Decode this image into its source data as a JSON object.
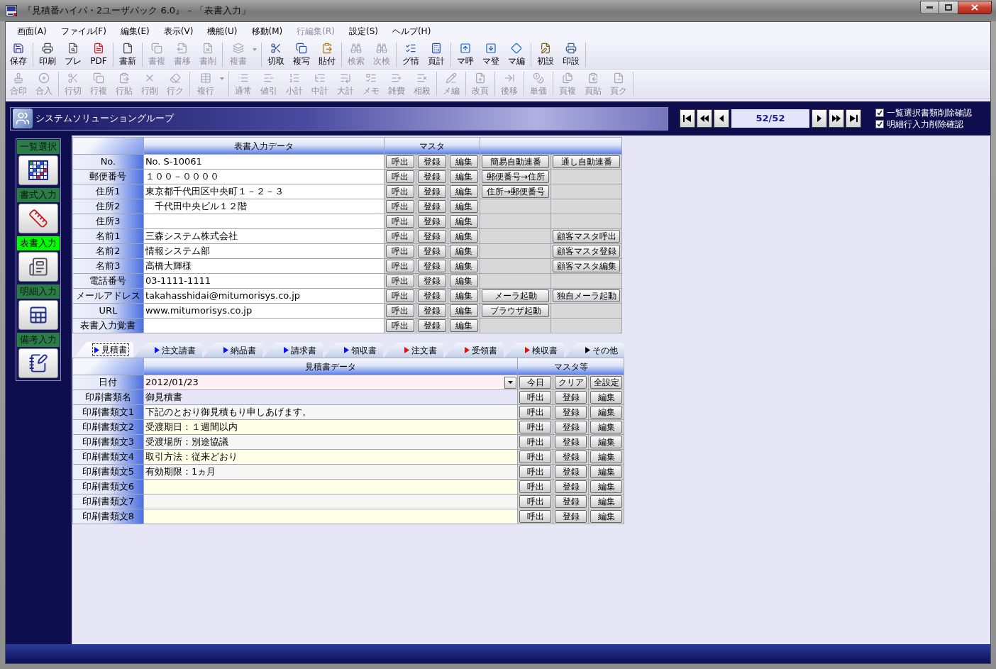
{
  "window": {
    "title": "『見積番ハイパ・2ユーザパック 6.0』 – 「表書入力」"
  },
  "menu": [
    {
      "label": "画面(A)",
      "disabled": false
    },
    {
      "label": "ファイル(F)",
      "disabled": false
    },
    {
      "label": "編集(E)",
      "disabled": false
    },
    {
      "label": "表示(V)",
      "disabled": false
    },
    {
      "label": "機能(U)",
      "disabled": false
    },
    {
      "label": "移動(M)",
      "disabled": false
    },
    {
      "label": "行編集(R)",
      "disabled": true
    },
    {
      "label": "設定(S)",
      "disabled": false
    },
    {
      "label": "ヘルプ(H)",
      "disabled": false
    }
  ],
  "toolbars": [
    {
      "items": [
        {
          "kind": "button",
          "label": "保存",
          "disabled": false
        },
        {
          "kind": "separator"
        },
        {
          "kind": "button",
          "label": "印刷",
          "disabled": false
        },
        {
          "kind": "button",
          "label": "プレ",
          "disabled": false
        },
        {
          "kind": "button",
          "label": "PDF",
          "disabled": false
        },
        {
          "kind": "separator"
        },
        {
          "kind": "button",
          "label": "書新",
          "disabled": false
        },
        {
          "kind": "separator"
        },
        {
          "kind": "button",
          "label": "書複",
          "disabled": true
        },
        {
          "kind": "button",
          "label": "書移",
          "disabled": true
        },
        {
          "kind": "button",
          "label": "書削",
          "disabled": true
        },
        {
          "kind": "separator"
        },
        {
          "kind": "button",
          "label": "複書",
          "disabled": true,
          "dropdown": true
        },
        {
          "kind": "separator"
        },
        {
          "kind": "button",
          "label": "切取",
          "disabled": false
        },
        {
          "kind": "button",
          "label": "複写",
          "disabled": false
        },
        {
          "kind": "button",
          "label": "貼付",
          "disabled": false
        },
        {
          "kind": "separator"
        },
        {
          "kind": "button",
          "label": "検索",
          "disabled": true
        },
        {
          "kind": "button",
          "label": "次検",
          "disabled": true
        },
        {
          "kind": "separator"
        },
        {
          "kind": "button",
          "label": "グ情",
          "disabled": false
        },
        {
          "kind": "button",
          "label": "頁計",
          "disabled": false
        },
        {
          "kind": "separator"
        },
        {
          "kind": "button",
          "label": "マ呼",
          "disabled": false
        },
        {
          "kind": "button",
          "label": "マ登",
          "disabled": false
        },
        {
          "kind": "button",
          "label": "マ編",
          "disabled": false
        },
        {
          "kind": "separator"
        },
        {
          "kind": "button",
          "label": "初設",
          "disabled": false
        },
        {
          "kind": "button",
          "label": "印設",
          "disabled": false
        },
        {
          "kind": "separator"
        }
      ]
    },
    {
      "items": [
        {
          "kind": "button",
          "label": "合印",
          "disabled": true
        },
        {
          "kind": "button",
          "label": "合入",
          "disabled": true
        },
        {
          "kind": "separator"
        },
        {
          "kind": "button",
          "label": "行切",
          "disabled": true
        },
        {
          "kind": "button",
          "label": "行複",
          "disabled": true
        },
        {
          "kind": "button",
          "label": "行貼",
          "disabled": true
        },
        {
          "kind": "button",
          "label": "行削",
          "disabled": true
        },
        {
          "kind": "button",
          "label": "行ク",
          "disabled": true
        },
        {
          "kind": "separator"
        },
        {
          "kind": "button",
          "label": "複行",
          "disabled": true,
          "dropdown": true
        },
        {
          "kind": "separator"
        },
        {
          "kind": "button",
          "label": "通常",
          "disabled": true
        },
        {
          "kind": "button",
          "label": "値引",
          "disabled": true
        },
        {
          "kind": "button",
          "label": "小計",
          "disabled": true
        },
        {
          "kind": "button",
          "label": "中計",
          "disabled": true
        },
        {
          "kind": "button",
          "label": "大計",
          "disabled": true
        },
        {
          "kind": "button",
          "label": "メモ",
          "disabled": true
        },
        {
          "kind": "button",
          "label": "雑費",
          "disabled": true
        },
        {
          "kind": "button",
          "label": "相殺",
          "disabled": true
        },
        {
          "kind": "separator"
        },
        {
          "kind": "button",
          "label": "メ編",
          "disabled": true
        },
        {
          "kind": "separator"
        },
        {
          "kind": "button",
          "label": "改頁",
          "disabled": true
        },
        {
          "kind": "separator"
        },
        {
          "kind": "button",
          "label": "後移",
          "disabled": true
        },
        {
          "kind": "separator"
        },
        {
          "kind": "button",
          "label": "単価",
          "disabled": true
        },
        {
          "kind": "separator"
        },
        {
          "kind": "button",
          "label": "頁複",
          "disabled": true
        },
        {
          "kind": "button",
          "label": "頁貼",
          "disabled": true
        },
        {
          "kind": "button",
          "label": "頁ク",
          "disabled": true
        },
        {
          "kind": "separator"
        }
      ]
    }
  ],
  "header": {
    "group_name": "システムソリューショングループ",
    "record": "52/52",
    "options": [
      {
        "label": "一覧選択書類削除確認",
        "checked": true
      },
      {
        "label": "明細行入力削除確認",
        "checked": true
      }
    ]
  },
  "sidebar": [
    {
      "label": "一覧選択",
      "selected": false
    },
    {
      "label": "書式入力",
      "selected": false
    },
    {
      "label": "表書入力",
      "selected": true
    },
    {
      "label": "明細入力",
      "selected": false
    },
    {
      "label": "備考入力",
      "selected": false
    }
  ],
  "cover_table": {
    "columns": [
      "表書入力データ",
      "マスタ"
    ],
    "rows": [
      {
        "label": "No.",
        "value": "No. S-10061",
        "buttons": [
          "呼出",
          "登録",
          "編集"
        ],
        "action_1": "簡易自動連番",
        "action_2": "通し自動連番"
      },
      {
        "label": "郵便番号",
        "value": "１００－００００",
        "buttons": [
          "呼出",
          "登録",
          "編集"
        ],
        "action_1": "郵便番号→住所"
      },
      {
        "label": "住所1",
        "value": "東京都千代田区中央町１－２－３",
        "buttons": [
          "呼出",
          "登録",
          "編集"
        ],
        "action_1": "住所→郵便番号"
      },
      {
        "label": "住所2",
        "value": "　千代田中央ビル１２階",
        "buttons": [
          "呼出",
          "登録",
          "編集"
        ]
      },
      {
        "label": "住所3",
        "buttons": [
          "呼出",
          "登録",
          "編集"
        ]
      },
      {
        "label": "名前1",
        "value": "三森システム株式会社",
        "buttons": [
          "呼出",
          "登録",
          "編集"
        ],
        "action_2": "顧客マスタ呼出"
      },
      {
        "label": "名前2",
        "value": "情報システム部",
        "buttons": [
          "呼出",
          "登録",
          "編集"
        ],
        "action_2": "顧客マスタ登録"
      },
      {
        "label": "名前3",
        "value": "高橋大輝様",
        "buttons": [
          "呼出",
          "登録",
          "編集"
        ],
        "action_2": "顧客マスタ編集"
      },
      {
        "label": "電話番号",
        "value": "03-1111-1111",
        "buttons": [
          "呼出",
          "登録",
          "編集"
        ]
      },
      {
        "label": "メールアドレス",
        "value": "takahasshidai@mitumorisys.co.jp",
        "buttons": [
          "呼出",
          "登録",
          "編集"
        ],
        "action_1": "メーラ起動",
        "action_2": "独自メーラ起動"
      },
      {
        "label": "URL",
        "value": "www.mitumorisys.co.jp",
        "buttons": [
          "呼出",
          "登録",
          "編集"
        ],
        "action_1": "ブラウザ起動"
      },
      {
        "label": "表書入力覚書",
        "buttons": [
          "呼出",
          "登録",
          "編集"
        ]
      }
    ]
  },
  "document_tabs": [
    {
      "label": "見積書",
      "selected": true,
      "color": "#1010ff"
    },
    {
      "label": "注文請書",
      "selected": false,
      "color": "#1010ff"
    },
    {
      "label": "納品書",
      "selected": false,
      "color": "#1010ff"
    },
    {
      "label": "請求書",
      "selected": false,
      "color": "#1010ff"
    },
    {
      "label": "領収書",
      "selected": false,
      "color": "#1010ff"
    },
    {
      "label": "注文書",
      "selected": false,
      "color": "#e01010"
    },
    {
      "label": "受領書",
      "selected": false,
      "color": "#e01010"
    },
    {
      "label": "検収書",
      "selected": false,
      "color": "#e01010"
    },
    {
      "label": "その他",
      "selected": false,
      "color": "#000000"
    }
  ],
  "document_table": {
    "columns": [
      "見積書データ",
      "マスタ等"
    ],
    "rows": [
      {
        "kind": "date",
        "label": "日付",
        "value": "2012/01/23",
        "buttons": [
          "今日",
          "クリア",
          "全設定"
        ]
      },
      {
        "kind": "name",
        "label": "印刷書類名",
        "value": "御見積書",
        "buttons": [
          "呼出",
          "登録",
          "編集"
        ]
      },
      {
        "kind": "text",
        "label": "印刷書類文1",
        "value": "下記のとおり御見積もり申しあげます。",
        "buttons": [
          "呼出",
          "登録",
          "編集"
        ]
      },
      {
        "kind": "text",
        "label": "印刷書類文2",
        "value": "受渡期日：１週間以内",
        "buttons": [
          "呼出",
          "登録",
          "編集"
        ]
      },
      {
        "kind": "text",
        "label": "印刷書類文3",
        "value": "受渡場所：別途協議",
        "buttons": [
          "呼出",
          "登録",
          "編集"
        ]
      },
      {
        "kind": "text",
        "label": "印刷書類文4",
        "value": "取引方法：従来どおり",
        "buttons": [
          "呼出",
          "登録",
          "編集"
        ]
      },
      {
        "kind": "text",
        "label": "印刷書類文5",
        "value": "有効期限：1ヵ月",
        "buttons": [
          "呼出",
          "登録",
          "編集"
        ]
      },
      {
        "kind": "text",
        "label": "印刷書類文6",
        "buttons": [
          "呼出",
          "登録",
          "編集"
        ]
      },
      {
        "kind": "text",
        "label": "印刷書類文7",
        "buttons": [
          "呼出",
          "登録",
          "編集"
        ]
      },
      {
        "kind": "text",
        "label": "印刷書類文8",
        "buttons": [
          "呼出",
          "登録",
          "編集"
        ]
      }
    ]
  }
}
